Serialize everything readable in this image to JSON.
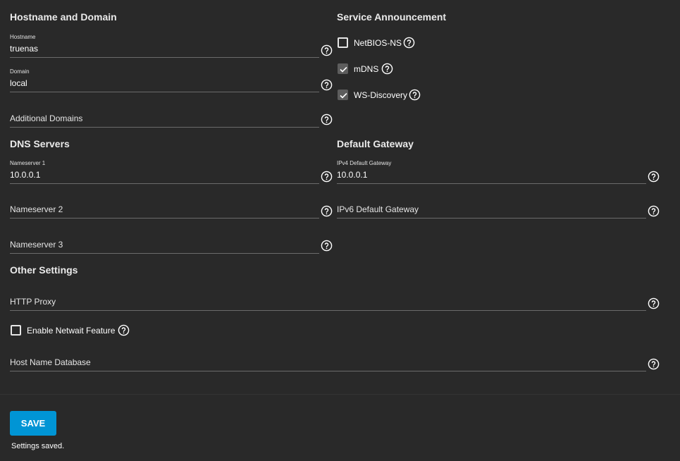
{
  "sections": {
    "hostname_domain": "Hostname and Domain",
    "service_announcement": "Service Announcement",
    "dns_servers": "DNS Servers",
    "default_gateway": "Default Gateway",
    "other_settings": "Other Settings"
  },
  "fields": {
    "hostname": {
      "label": "Hostname",
      "value": "truenas"
    },
    "domain": {
      "label": "Domain",
      "value": "local"
    },
    "additional_domains": {
      "placeholder": "Additional Domains"
    },
    "nameserver1": {
      "label": "Nameserver 1",
      "value": "10.0.0.1"
    },
    "nameserver2": {
      "placeholder": "Nameserver 2"
    },
    "nameserver3": {
      "placeholder": "Nameserver 3"
    },
    "ipv4_gateway": {
      "label": "IPv4 Default Gateway",
      "value": "10.0.0.1"
    },
    "ipv6_gateway": {
      "placeholder": "IPv6 Default Gateway"
    },
    "http_proxy": {
      "placeholder": "HTTP Proxy"
    },
    "host_name_database": {
      "placeholder": "Host Name Database"
    }
  },
  "checkboxes": {
    "netbios_ns": {
      "label": "NetBIOS-NS",
      "checked": false
    },
    "mdns": {
      "label": "mDNS",
      "checked": true
    },
    "ws_discovery": {
      "label": "WS-Discovery",
      "checked": true
    },
    "netwait": {
      "label": "Enable Netwait Feature",
      "checked": false
    }
  },
  "actions": {
    "save_label": "SAVE",
    "status": "Settings saved."
  },
  "colors": {
    "background": "#292929",
    "accent": "#0095d5",
    "underline": "#6b6b6b"
  },
  "icons": {
    "help": "help-circle-icon",
    "check": "check-icon"
  }
}
